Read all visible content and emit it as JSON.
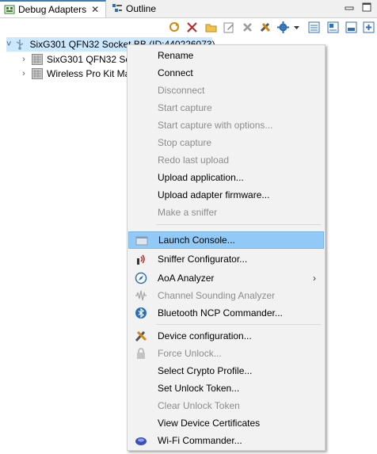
{
  "tabs": [
    {
      "label": "Debug Adapters",
      "icon": "debug-adapters-icon",
      "closable": true,
      "active": true
    },
    {
      "label": "Outline",
      "icon": "outline-icon",
      "closable": false,
      "active": false
    }
  ],
  "toolbar": {
    "icons": [
      "refresh-devices-icon",
      "disconnect-all-icon",
      "folder-icon",
      "edit-icon",
      "remove-icon",
      "tools-icon",
      "gear-icon",
      "dropdown-arrow-icon",
      "view-menu-icon",
      "layout-icon",
      "minimize-icon",
      "maximize-icon"
    ]
  },
  "tree": {
    "items": [
      {
        "label": "SixG301 QFN32 Socket BB (ID:440226073)",
        "expanded": true,
        "selected": true,
        "icon": "usb-adapter-icon"
      },
      {
        "label": "SixG301 QFN32 Socket BB",
        "expanded": false,
        "selected": false,
        "icon": "board-icon"
      },
      {
        "label": "Wireless Pro Kit Mainboard",
        "expanded": false,
        "selected": false,
        "icon": "board-icon"
      }
    ]
  },
  "menu": {
    "items": [
      {
        "label": "Rename",
        "enabled": true
      },
      {
        "label": "Connect",
        "enabled": true
      },
      {
        "label": "Disconnect",
        "enabled": false
      },
      {
        "label": "Start capture",
        "enabled": false
      },
      {
        "label": "Start capture with options...",
        "enabled": false
      },
      {
        "label": "Stop capture",
        "enabled": false
      },
      {
        "label": "Redo last upload",
        "enabled": false
      },
      {
        "label": "Upload application...",
        "enabled": true
      },
      {
        "label": "Upload adapter firmware...",
        "enabled": true
      },
      {
        "label": "Make a sniffer",
        "enabled": false
      },
      {
        "label": "Launch Console...",
        "enabled": true,
        "highlighted": true,
        "icon": "console-icon"
      },
      {
        "label": "Sniffer Configurator...",
        "enabled": true,
        "icon": "sniffer-icon"
      },
      {
        "label": "AoA Analyzer",
        "enabled": true,
        "icon": "compass-icon",
        "submenu": true
      },
      {
        "label": "Channel Sounding Analyzer",
        "enabled": false,
        "icon": "waveform-icon"
      },
      {
        "label": "Bluetooth NCP Commander...",
        "enabled": true,
        "icon": "bluetooth-icon"
      },
      {
        "label": "Device configuration...",
        "enabled": true,
        "icon": "tools-icon"
      },
      {
        "label": "Force Unlock...",
        "enabled": false,
        "icon": "lock-icon"
      },
      {
        "label": "Select Crypto Profile...",
        "enabled": true
      },
      {
        "label": "Set Unlock Token...",
        "enabled": true
      },
      {
        "label": "Clear Unlock Token",
        "enabled": false
      },
      {
        "label": "View Device Certificates",
        "enabled": true
      },
      {
        "label": "Wi-Fi Commander...",
        "enabled": true,
        "icon": "wifi-commander-icon"
      }
    ]
  },
  "colors": {
    "selection": "#cce8ff",
    "menu_highlight": "#91c9f7",
    "menu_background": "#f2f2f2",
    "disabled_text": "#8c8c8c",
    "tab_accent": "#3c7fb1"
  }
}
